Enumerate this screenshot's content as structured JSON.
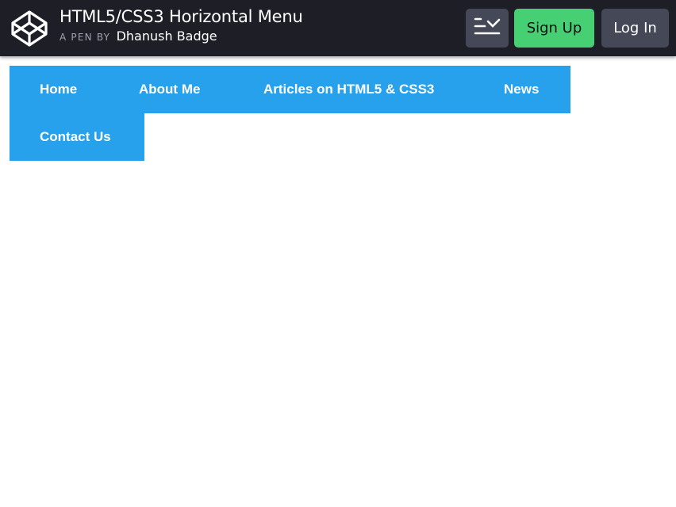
{
  "header": {
    "title": "HTML5/CSS3 Horizontal Menu",
    "byline_prefix": "A PEN BY",
    "author": "Dhanush Badge",
    "logo_icon": "codepen-logo-icon",
    "menu_icon": "list-check-icon",
    "signup_label": "Sign Up",
    "login_label": "Log In"
  },
  "menu": {
    "items": [
      {
        "label": "Home"
      },
      {
        "label": "About Me"
      },
      {
        "label": "Articles on HTML5 & CSS3"
      },
      {
        "label": "News"
      },
      {
        "label": "Contact Us"
      }
    ]
  },
  "colors": {
    "topbar_bg": "#1e1f26",
    "menu_bg": "#27a1ec",
    "signup_bg": "#47cf73",
    "dark_button_bg": "#444857"
  }
}
